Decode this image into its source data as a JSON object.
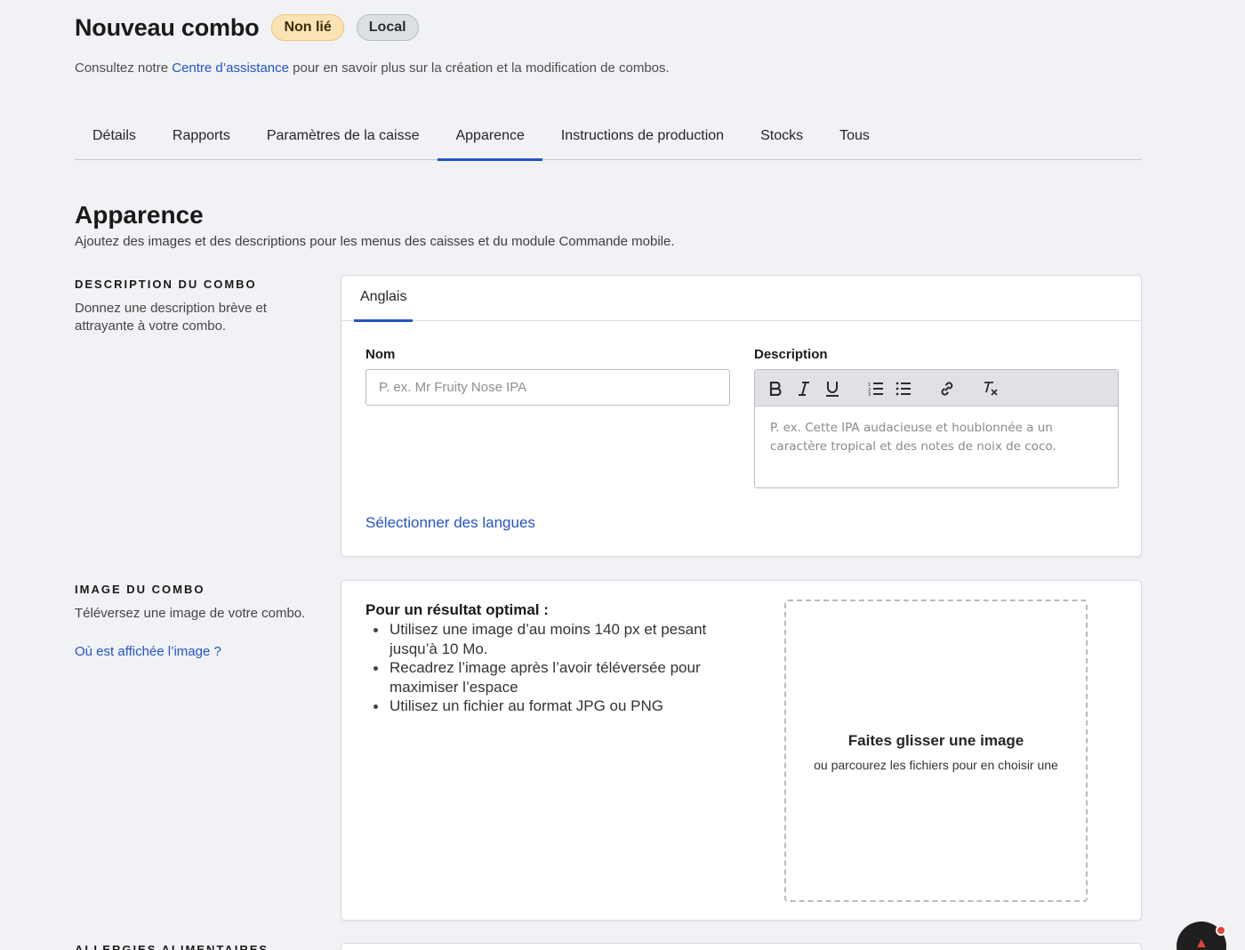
{
  "header": {
    "title": "Nouveau combo",
    "badges": [
      "Non lié",
      "Local"
    ],
    "subtitle_before": "Consultez notre ",
    "subtitle_link": "Centre d’assistance",
    "subtitle_after": " pour en savoir plus sur la création et la modification de combos."
  },
  "tabs": [
    "Détails",
    "Rapports",
    "Paramètres de la caisse",
    "Apparence",
    "Instructions de production",
    "Stocks",
    "Tous"
  ],
  "active_tab": "Apparence",
  "section": {
    "title": "Apparence",
    "subtitle": "Ajoutez des images et des descriptions pour les menus des caisses et du module Commande mobile."
  },
  "description_block": {
    "caption": "DESCRIPTION DU COMBO",
    "help": "Donnez une description brève et attrayante à votre combo.",
    "language_tab": "Anglais",
    "name_label": "Nom",
    "name_placeholder": "P. ex. Mr Fruity Nose IPA",
    "desc_label": "Description",
    "desc_placeholder": "P. ex. Cette IPA audacieuse et houblonnée a un caractère tropical et des notes de noix de coco.",
    "toolbar": [
      "bold-icon",
      "italic-icon",
      "underline-icon",
      "ordered-list-icon",
      "bullet-list-icon",
      "link-icon",
      "clear-format-icon"
    ],
    "select_languages": "Sélectionner des langues"
  },
  "image_block": {
    "caption": "IMAGE DU COMBO",
    "help": "Téléversez une image de votre combo.",
    "where_link": "Où est affichée l’image ?",
    "tips_title": "Pour un résultat optimal :",
    "tips": [
      "Utilisez une image d’au moins 140 px et pesant jusqu’à 10 Mo.",
      "Recadrez l’image après l’avoir téléversée pour maximiser l’espace",
      "Utilisez un fichier au format JPG ou PNG"
    ],
    "drop_title": "Faites glisser une image",
    "drop_sub": "ou parcourez les fichiers pour en choisir une"
  },
  "next_block": {
    "caption": "ALLERGIES ALIMENTAIRES"
  },
  "colors": {
    "accent": "#2453c9",
    "badge_unlinked": "#fce3b5",
    "badge_local": "#dcdfe3",
    "chat_notification": "#e8413a"
  }
}
